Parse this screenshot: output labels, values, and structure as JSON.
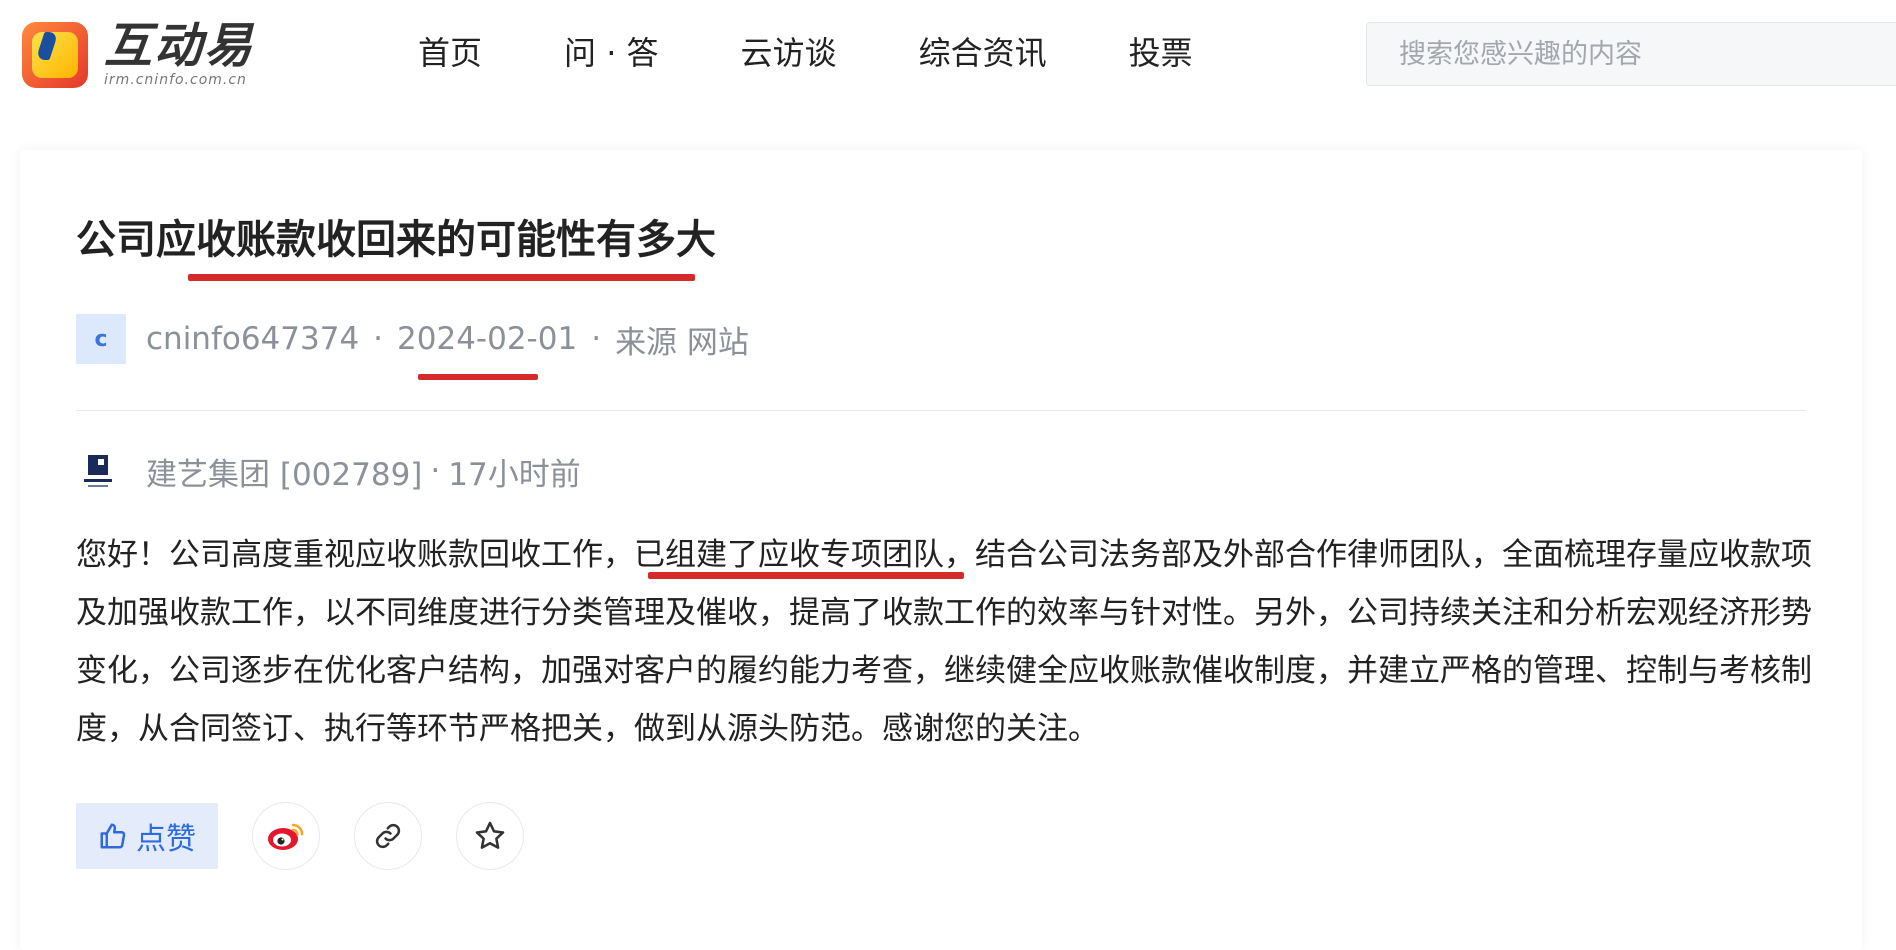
{
  "header": {
    "brand_name": "互动易",
    "brand_domain": "irm.cninfo.com.cn",
    "nav": [
      "首页",
      "问 · 答",
      "云访谈",
      "综合资讯",
      "投票"
    ],
    "search_placeholder": "搜索您感兴趣的内容"
  },
  "question": {
    "title": "公司应收账款收回来的可能性有多大",
    "avatar_letter": "c",
    "user": "cninfo647374",
    "date": "2024-02-01",
    "source": "来源 网站"
  },
  "answer": {
    "company": "建艺集团 [002789]",
    "time_ago": "17小时前",
    "text_before": "您好！公司高度重视应收账款回收工作，",
    "text_highlight": "已组建了应收专项团队",
    "text_after": "，结合公司法务部及外部合作律师团队，全面梳理存量应收款项及加强收款工作，以不同维度进行分类管理及催收，提高了收款工作的效率与针对性。另外，公司持续关注和分析宏观经济形势变化，公司逐步在优化客户结构，加强对客户的履约能力考查，继续健全应收账款催收制度，并建立严格的管理、控制与考核制度，从合同签订、执行等环节严格把关，做到从源头防范。感谢您的关注。"
  },
  "actions": {
    "like_label": "点赞",
    "icons": [
      "thumbs-up-icon",
      "weibo-icon",
      "link-icon",
      "star-icon"
    ]
  },
  "colors": {
    "accent_blue": "#2f6be0",
    "underline_red": "#d42a2a",
    "meta_gray": "#8b9099"
  }
}
